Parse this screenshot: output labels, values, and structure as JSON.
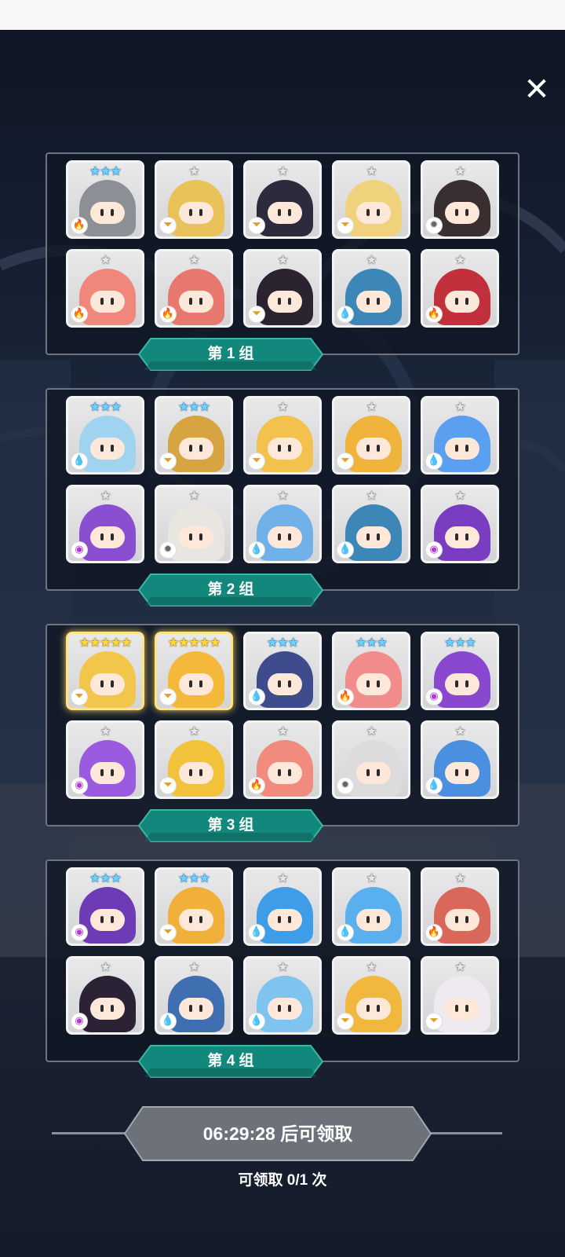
{
  "close_label": "✕",
  "groups": [
    {
      "label": "第 1 组",
      "heroes": [
        {
          "stars": "★★★",
          "rank": 3,
          "element": "fire",
          "icon": "🔥",
          "color": "#8c8f96"
        },
        {
          "stars": "★",
          "rank": 1,
          "element": "earth",
          "icon": "⏷",
          "color": "#e9c25a"
        },
        {
          "stars": "★",
          "rank": 1,
          "element": "earth",
          "icon": "⏷",
          "color": "#2d2a3e"
        },
        {
          "stars": "★",
          "rank": 1,
          "element": "earth",
          "icon": "⏷",
          "color": "#f1d27c"
        },
        {
          "stars": "★",
          "rank": 1,
          "element": "light",
          "icon": "✹",
          "color": "#3a2f30"
        },
        {
          "stars": "★",
          "rank": 1,
          "element": "fire",
          "icon": "🔥",
          "color": "#f0877a"
        },
        {
          "stars": "★",
          "rank": 1,
          "element": "fire",
          "icon": "🔥",
          "color": "#e8776e"
        },
        {
          "stars": "★",
          "rank": 1,
          "element": "earth",
          "icon": "⏷",
          "color": "#2b2430"
        },
        {
          "stars": "★",
          "rank": 1,
          "element": "water",
          "icon": "💧",
          "color": "#3c86b8"
        },
        {
          "stars": "★",
          "rank": 1,
          "element": "fire",
          "icon": "🔥",
          "color": "#c2313b"
        }
      ]
    },
    {
      "label": "第 2 组",
      "heroes": [
        {
          "stars": "★★★",
          "rank": 3,
          "element": "water",
          "icon": "💧",
          "color": "#9fd3f0"
        },
        {
          "stars": "★★★",
          "rank": 3,
          "element": "earth",
          "icon": "⏷",
          "color": "#d6a541"
        },
        {
          "stars": "★",
          "rank": 1,
          "element": "earth",
          "icon": "⏷",
          "color": "#f3c24e"
        },
        {
          "stars": "★",
          "rank": 1,
          "element": "earth",
          "icon": "⏷",
          "color": "#f0b43c"
        },
        {
          "stars": "★",
          "rank": 1,
          "element": "water",
          "icon": "💧",
          "color": "#5a9ff0"
        },
        {
          "stars": "★",
          "rank": 1,
          "element": "dark",
          "icon": "◉",
          "color": "#8a4fd1"
        },
        {
          "stars": "★",
          "rank": 1,
          "element": "light",
          "icon": "✹",
          "color": "#e9e6e2"
        },
        {
          "stars": "★",
          "rank": 1,
          "element": "water",
          "icon": "💧",
          "color": "#6fb1e8"
        },
        {
          "stars": "★",
          "rank": 1,
          "element": "water",
          "icon": "💧",
          "color": "#3c86b8"
        },
        {
          "stars": "★",
          "rank": 1,
          "element": "dark",
          "icon": "◉",
          "color": "#7a3dc2"
        }
      ]
    },
    {
      "label": "第 3 组",
      "heroes": [
        {
          "stars": "★★★★★",
          "rank": 5,
          "element": "earth",
          "icon": "⏷",
          "color": "#f1c64a"
        },
        {
          "stars": "★★★★★",
          "rank": 5,
          "element": "earth",
          "icon": "⏷",
          "color": "#f4b83a"
        },
        {
          "stars": "★★★",
          "rank": 3,
          "element": "water",
          "icon": "💧",
          "color": "#3e4b8c"
        },
        {
          "stars": "★★★",
          "rank": 3,
          "element": "fire",
          "icon": "🔥",
          "color": "#f08c8c"
        },
        {
          "stars": "★★★",
          "rank": 3,
          "element": "dark",
          "icon": "◉",
          "color": "#8a47d0"
        },
        {
          "stars": "★",
          "rank": 1,
          "element": "dark",
          "icon": "◉",
          "color": "#9b5be0"
        },
        {
          "stars": "★",
          "rank": 1,
          "element": "earth",
          "icon": "⏷",
          "color": "#f2c23a"
        },
        {
          "stars": "★",
          "rank": 1,
          "element": "fire",
          "icon": "🔥",
          "color": "#f08b7e"
        },
        {
          "stars": "★",
          "rank": 1,
          "element": "light",
          "icon": "✹",
          "color": "#dcdcdc"
        },
        {
          "stars": "★",
          "rank": 1,
          "element": "water",
          "icon": "💧",
          "color": "#4a8fe0"
        }
      ]
    },
    {
      "label": "第 4 组",
      "heroes": [
        {
          "stars": "★★★",
          "rank": 3,
          "element": "dark",
          "icon": "◉",
          "color": "#6c3bb5"
        },
        {
          "stars": "★★★",
          "rank": 3,
          "element": "earth",
          "icon": "⏷",
          "color": "#f0b03a"
        },
        {
          "stars": "★",
          "rank": 1,
          "element": "water",
          "icon": "💧",
          "color": "#3e9de8"
        },
        {
          "stars": "★",
          "rank": 1,
          "element": "water",
          "icon": "💧",
          "color": "#5ab0ee"
        },
        {
          "stars": "★",
          "rank": 1,
          "element": "fire",
          "icon": "🔥",
          "color": "#d9685a"
        },
        {
          "stars": "★",
          "rank": 1,
          "element": "dark",
          "icon": "◉",
          "color": "#2b2236"
        },
        {
          "stars": "★",
          "rank": 1,
          "element": "water",
          "icon": "💧",
          "color": "#3f6fb0"
        },
        {
          "stars": "★",
          "rank": 1,
          "element": "water",
          "icon": "💧",
          "color": "#7fc4ee"
        },
        {
          "stars": "★",
          "rank": 1,
          "element": "earth",
          "icon": "⏷",
          "color": "#f2b83e"
        },
        {
          "stars": "★",
          "rank": 1,
          "element": "earth",
          "icon": "⏷",
          "color": "#eeeaf0"
        }
      ]
    }
  ],
  "claim": {
    "button_label": "06:29:28 后可领取",
    "count_label": "可领取 0/1 次"
  },
  "colors": {
    "label_teal": "#12877b",
    "label_teal_dark": "#0b5e56",
    "button_gray": "#6c717a",
    "gold": "#ffd93a",
    "blue_star": "#6dd2ff"
  }
}
